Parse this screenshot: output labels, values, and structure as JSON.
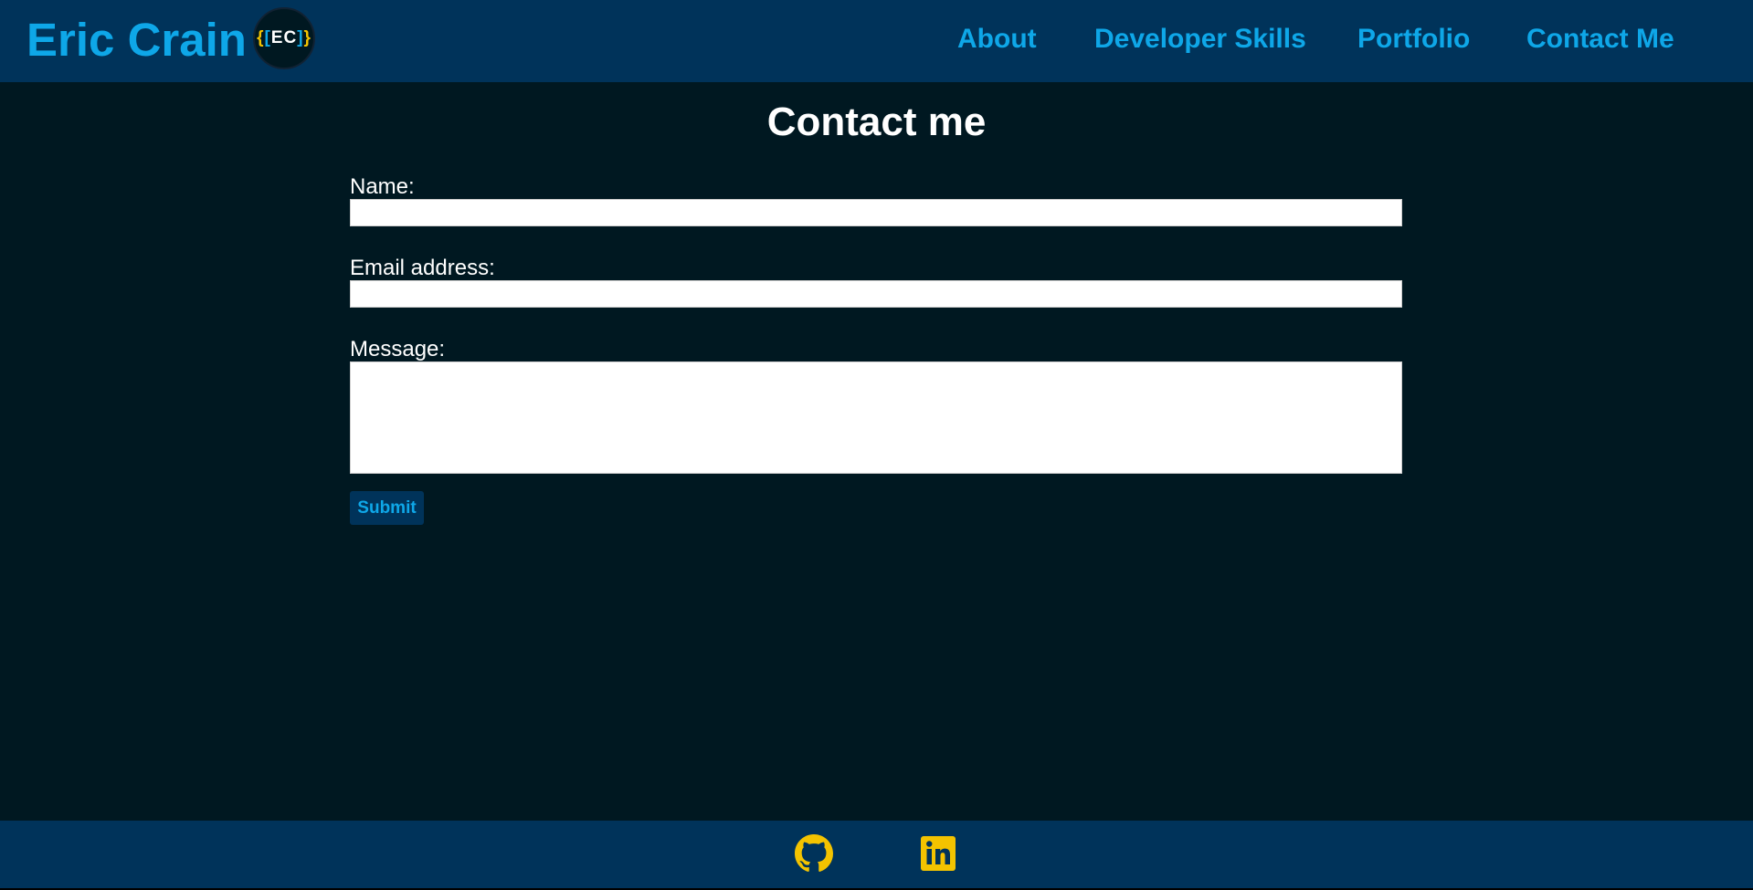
{
  "header": {
    "brand": "Eric Crain",
    "logo": {
      "left_brace": "{",
      "left_bracket": "[",
      "initials": "EC",
      "right_bracket": "]",
      "right_brace": "}"
    },
    "nav": [
      "About",
      "Developer Skills",
      "Portfolio",
      "Contact Me"
    ]
  },
  "main": {
    "title": "Contact me",
    "form": {
      "name_label": "Name:",
      "name_value": "",
      "email_label": "Email address:",
      "email_value": "",
      "message_label": "Message:",
      "message_value": "",
      "submit_label": "Submit"
    }
  },
  "footer": {
    "icons": [
      "github-icon",
      "linkedin-icon"
    ]
  },
  "colors": {
    "header_bg": "#00335a",
    "page_bg": "#001821",
    "accent": "#0ea7e8",
    "icon": "#f3c300"
  }
}
